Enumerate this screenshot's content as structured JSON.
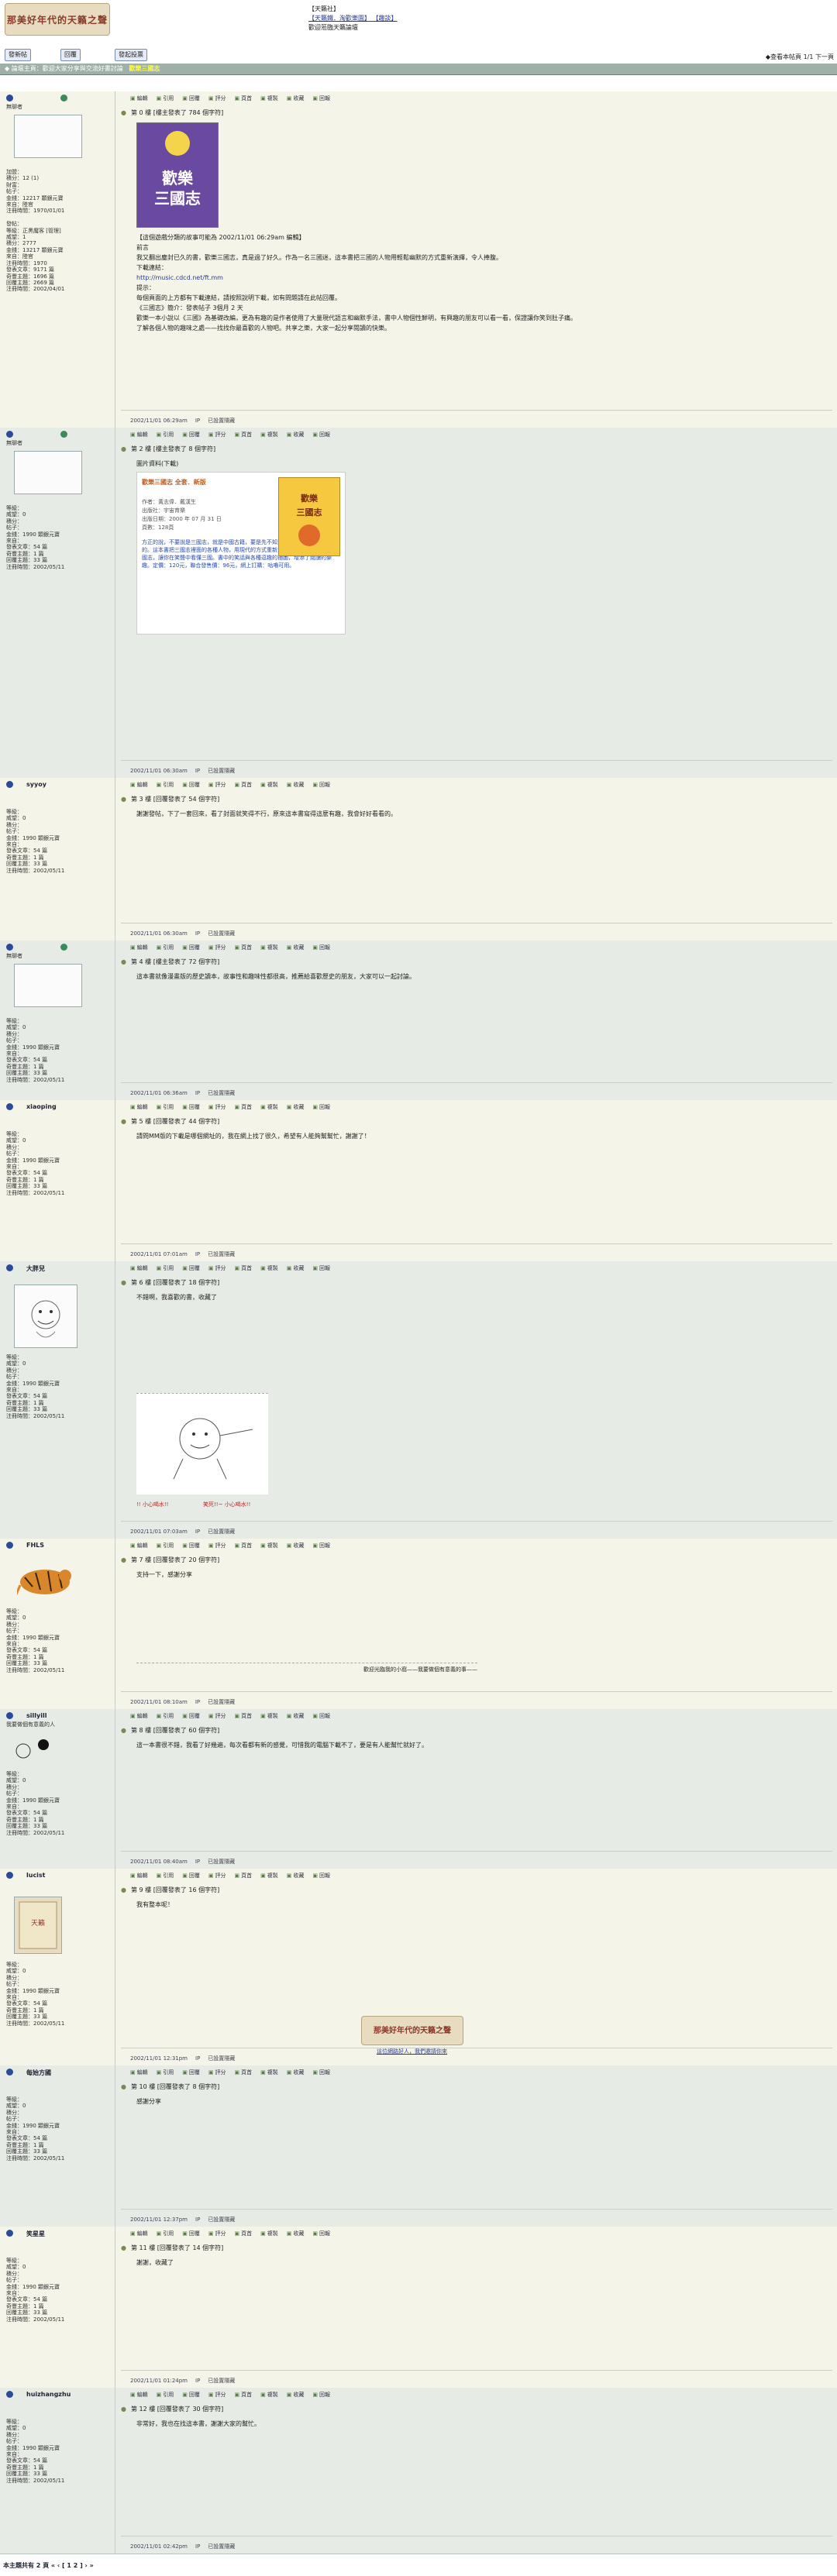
{
  "header": {
    "logo_text": "那美好年代的天籟之聲",
    "top_line1": "【天籟社】",
    "top_line2": "【天籟鐵．淘歡樂園】  【趣談】",
    "top_line3": "歡迎蒞臨天籟論壇",
    "toolbar_new_topic": "發新帖",
    "toolbar_reply": "回覆",
    "toolbar_poll": "發起投票",
    "toolbar_right": "◆查看本帖頁 1/1 下一頁"
  },
  "breadcrumb": {
    "text": "◆ 論壇主頁：歡迎大家分享與交流好書討論",
    "topic": "歡樂三國志"
  },
  "actions": [
    "編輯",
    "引用",
    "回覆",
    "評分",
    "頁首",
    "複製",
    "收藏",
    "回報"
  ],
  "posts": [
    {
      "name": "",
      "subtitle": "無聊者",
      "info": "加盟：\n積分：12 (1)\n財富：\n帖子：\n金錢：12217 顆銀元寶\n來自：陸官\n注冊時間：1970/01/01\n\n發帖：\n等級：正黑魔客 [管理]\n威望：1\n積分：2777\n金錢：13217 顆銀元寶\n來自：陸官\n注冊時間：1970\n發表文章：9171 篇\n奇豐主題：1696 篇\n回覆主題：2669 篇\n注冊時間：2002/04/01",
      "title": "第 0 樓  [樓主發表了 784 個字符]",
      "body_lines": [
        "【這個遊戲分類的故事可能為 2002/11/01 06:29am 編輯】",
        "前言",
        "我又翻出塵封已久的書，歡樂三國志，真是過了好久。作為一名三國迷，這本書把三國的人物用輕鬆幽默的方式重新演繹，令人捧腹。",
        "下載連結：",
        "http://music.cdcd.net/ft.mm",
        "提示：",
        "每個頁面的上方都有下載連結，請按照說明下載，如有問題請在此帖回覆。",
        "  《三國志》簡介：發表帖子 3個月 2 天",
        "歡樂一本小說以《三國》為基礎改編，更為有趣的是作者使用了大量現代語言和幽默手法，書中人物個性鮮明，有興趣的朋友可以看一看，保證讓你笑到肚子痛。",
        "了解各個人物的趣味之處——找找你最喜歡的人物吧。共享之樂，大家一起分享閱讀的快樂。"
      ],
      "footer_date": "2002/11/01 06:29am",
      "footer_ip": "IP",
      "footer_report": "已設置隱藏"
    },
    {
      "name": "",
      "subtitle": "無聊者",
      "title": "第 2 樓  [樓主發表了 8 個字符]",
      "quote_label": "圖片資料(下載)",
      "book_title": "歡樂三國志 全套．新版",
      "book_meta": [
        "作者：黃志偉．戴漢生",
        "出版社：宇宙育樂",
        "出版日期：2000 年 07 月 31 日",
        "頁數：128頁"
      ],
      "book_desc": "方正的說，不要說是三國志，就是中國古籍，要是先不知道從來，是不能夠理解的。這本書把三國志裡面的各種人物，用現代的方式重新演繹，有笑有淚。歡樂三國志，讓你在笑聲中看懂三國。書中的笑話與各種逗趣的插圖，增添了閱讀的樂趣。定價：120元，聯合發售價：96元，網上訂購：咕嚕可用。",
      "footer_date": "2002/11/01 06:30am",
      "footer_ip": "IP",
      "footer_report": "已設置隱藏"
    },
    {
      "name": "syyoy",
      "title": "第 3 樓  [回覆發表了 54 個字符]",
      "body": "謝謝發帖，下了一套回來，看了封面就笑得不行，原來這本書寫得這麼有趣，我會好好看看的。",
      "footer_date": "2002/11/01 06:30am",
      "footer_ip": "IP",
      "footer_report": "已設置隱藏"
    },
    {
      "name": "",
      "subtitle": "無聊者",
      "title": "第 4 樓  [樓主發表了 72 個字符]",
      "body": "這本書就像漫畫版的歷史讀本，故事性和趣味性都很高，推薦給喜歡歷史的朋友，大家可以一起討論。",
      "footer_date": "2002/11/01 06:36am",
      "footer_ip": "IP",
      "footer_report": "已設置隱藏"
    },
    {
      "name": "xiaoping",
      "title": "第 5 樓  [回覆發表了 44 個字符]",
      "body": "請問MM版的下載是哪個網址的，我在網上找了很久，希望有人能夠幫幫忙，謝謝了！",
      "footer_date": "2002/11/01 07:01am",
      "footer_ip": "IP",
      "footer_report": "已設置隱藏"
    },
    {
      "name": "大胖兒",
      "title": "第 6 樓  [回覆發表了 18 個字符]",
      "body": "不錯啊，我喜歡的書，收藏了",
      "sig_caption_left": "!! 小心喝水!!",
      "sig_caption_right": "笑死!!~ 小心喝水!!",
      "footer_date": "2002/11/01 07:03am",
      "footer_ip": "IP",
      "footer_report": "已設置隱藏"
    },
    {
      "name": "FHLS",
      "title": "第 7 樓  [回覆發表了 20 個字符]",
      "body": "支持一下，感謝分享",
      "sig_text": "歡迎光臨我的小窩——我要做個有意義的事——",
      "footer_date": "2002/11/01 08:10am",
      "footer_ip": "IP",
      "footer_report": "已設置隱藏"
    },
    {
      "name": "sillyill",
      "subtitle": "我要做個有意義的人",
      "title": "第 8 樓  [回覆發表了 60 個字符]",
      "body": "這一本書很不錯，我看了好幾遍，每次看都有新的感覺，可惜我的電腦下載不了，要是有人能幫忙就好了。",
      "footer_date": "2002/11/01 08:40am",
      "footer_ip": "IP",
      "footer_report": "已設置隱藏"
    },
    {
      "name": "lucist",
      "title": "第 9 樓  [回覆發表了 16 個字符]",
      "body": "我有整本呢！",
      "sig_link": "這位網路好人，我們邀請你來",
      "footer_date": "2002/11/01 12:31pm",
      "footer_ip": "IP",
      "footer_report": "已設置隱藏"
    },
    {
      "name": "每始方國",
      "title": "第 10 樓  [回覆發表了 8 個字符]",
      "body": "感謝分享",
      "footer_date": "2002/11/01 12:37pm",
      "footer_ip": "IP",
      "footer_report": "已設置隱藏"
    },
    {
      "name": "笑星星",
      "title": "第 11 樓  [回覆發表了 14 個字符]",
      "body": "謝謝，收藏了",
      "footer_date": "2002/11/01 01:24pm",
      "footer_ip": "IP",
      "footer_report": "已設置隱藏"
    },
    {
      "name": "huizhangzhu",
      "title": "第 12 樓  [回覆發表了 30 個字符]",
      "body": "非常好，我也在找這本書，謝謝大家的幫忙。",
      "footer_date": "2002/11/01 02:42pm",
      "footer_ip": "IP",
      "footer_report": "已設置隱藏"
    }
  ],
  "generic_user_info": "等級：\n威望：0\n積分：\n帖子：\n金錢：1990 顆銀元寶\n來自：\n發表文章：54 篇\n奇豐主題：1 篇\n回覆主題：33 篇\n注冊時間：2002/05/11",
  "pager": "本主題共有 2 頁 « ‹ [ 1 2 ] › »"
}
